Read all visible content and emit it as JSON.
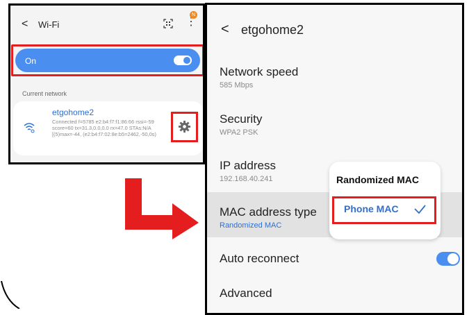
{
  "left_screen": {
    "title": "Wi-Fi",
    "back_glyph": "<",
    "more_glyph": "⋮",
    "notification_badge": "N",
    "wifi_toggle_label": "On",
    "wifi_on": true,
    "current_network_label": "Current network",
    "network": {
      "name": "etgohome2",
      "details": "Connected f=5785  e2:b4:f7:f1:86:66 rssi=-59  score=60 tx=31.3,0.0,0.0 rx=47.0 STAs:N/A [(5)max=-44, (e2:b4:f7:02:8e:b5=2462,-50,0s)"
    },
    "icons": [
      "qr-scan-icon",
      "more-options-icon",
      "wifi-signal-icon",
      "gear-icon"
    ]
  },
  "right_screen": {
    "title": "etgohome2",
    "back_glyph": "<",
    "items": [
      {
        "label": "Network speed",
        "value": "585 Mbps"
      },
      {
        "label": "Security",
        "value": "WPA2 PSK"
      },
      {
        "label": "IP address",
        "value": "192.168.40.241"
      },
      {
        "label": "MAC address type",
        "value": "Randomized MAC"
      },
      {
        "label": "Auto reconnect",
        "value": ""
      },
      {
        "label": "Advanced",
        "value": ""
      }
    ],
    "auto_reconnect_on": true,
    "mac_popup": {
      "options": [
        "Randomized MAC",
        "Phone MAC"
      ],
      "selected": "Phone MAC"
    }
  },
  "colors": {
    "accent_blue": "#4a8ef0",
    "highlight_red": "#e41e1e",
    "link_blue": "#2f6fd1"
  }
}
